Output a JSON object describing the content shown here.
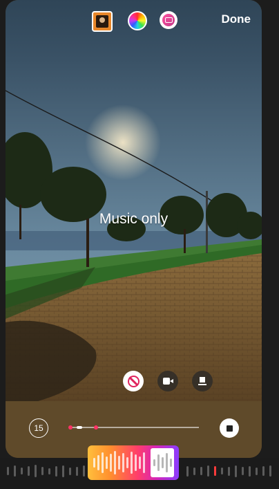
{
  "header": {
    "done_label": "Done",
    "icons": [
      "sticker-thumbnail-icon",
      "color-wheel-icon",
      "chat-sticker-icon"
    ]
  },
  "caption": {
    "text": "Music only"
  },
  "modes": [
    {
      "name": "no-video",
      "icon": "ban-icon",
      "selected": true
    },
    {
      "name": "video",
      "icon": "video-camera-icon",
      "selected": false
    },
    {
      "name": "card",
      "icon": "card-icon",
      "selected": false
    }
  ],
  "playback": {
    "duration_label": "15",
    "progress": 0.12
  },
  "colors": {
    "accent": "#ff3366",
    "done": "#ffffff",
    "selector_gradient": [
      "#ffbf3c",
      "#ff8e2e",
      "#ff3d6b",
      "#d726b7",
      "#8a3dff"
    ]
  }
}
